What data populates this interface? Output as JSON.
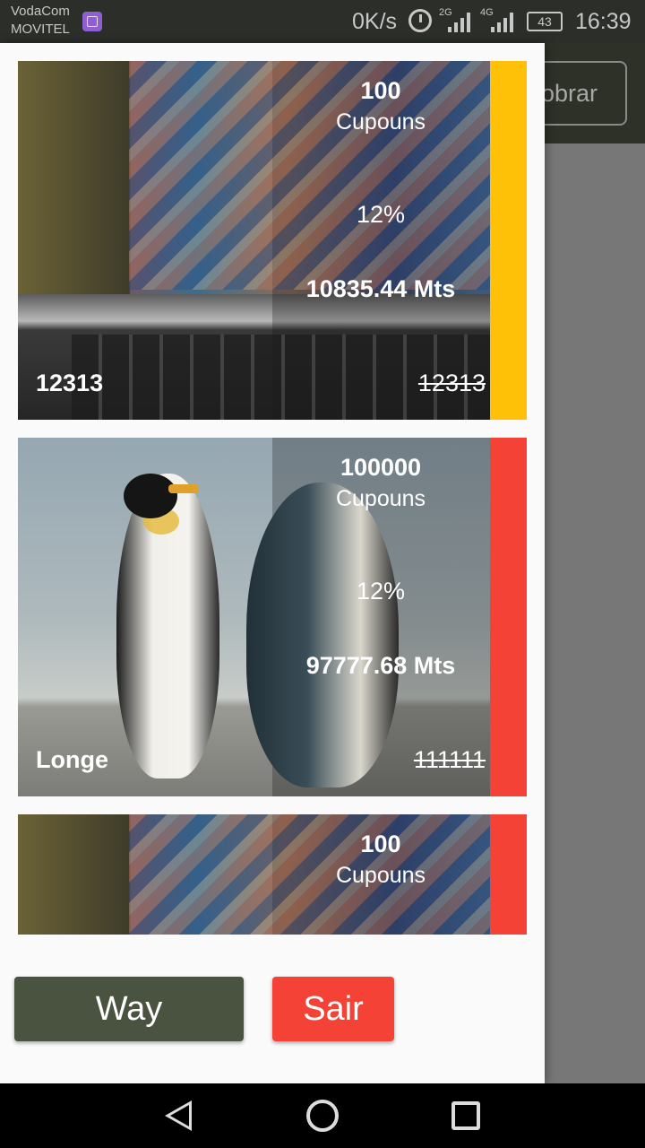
{
  "status_bar": {
    "carrier_line1": "VodaCom",
    "carrier_line2": "MOVITEL",
    "net_speed": "0K/s",
    "signal1_label": "2G",
    "signal2_label": "4G",
    "battery": "43",
    "time": "16:39"
  },
  "background": {
    "button_label": "obrar"
  },
  "cards": [
    {
      "amount": "100",
      "amount_label": "Cupouns",
      "percent": "12%",
      "price": "10835.44 Mts",
      "name": "12313",
      "old_price": "12313",
      "image": "laptop-photo",
      "stripe_color": "#FFC107"
    },
    {
      "amount": "100000",
      "amount_label": "Cupouns",
      "percent": "12%",
      "price": "97777.68 Mts",
      "name": "Longe",
      "old_price": "111111",
      "image": "penguins-photo",
      "stripe_color": "#F44336"
    },
    {
      "amount": "100",
      "amount_label": "Cupouns",
      "image": "laptop-photo",
      "stripe_color": "#F44336"
    }
  ],
  "buttons": {
    "way": "Way",
    "sair": "Sair"
  },
  "colors": {
    "way_button": "#4A5240",
    "sair_button": "#F44336"
  },
  "nav_icons": [
    "back-icon",
    "home-icon",
    "recent-apps-icon"
  ]
}
